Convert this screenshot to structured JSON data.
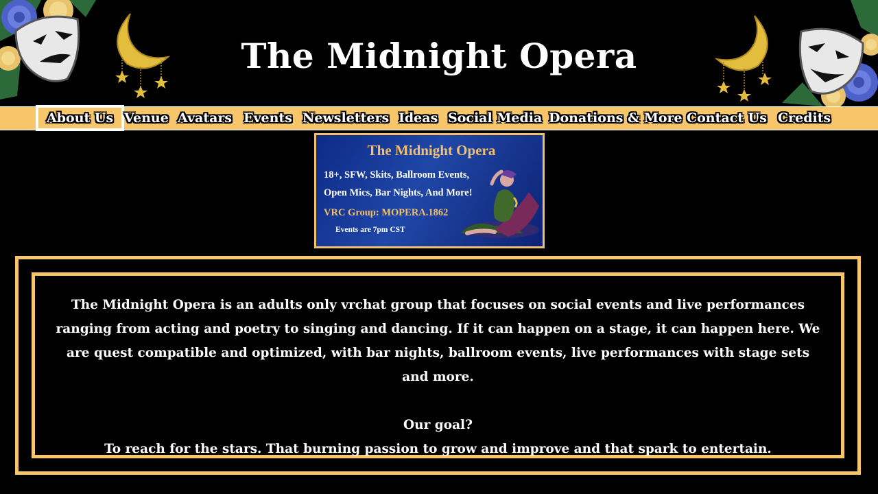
{
  "header": {
    "title": "The Midnight Opera",
    "decorations": [
      "rose-bouquet-icon",
      "comedy-mask-icon",
      "crescent-moon-icon",
      "star-icon",
      "tragedy-mask-icon"
    ]
  },
  "nav": {
    "items": [
      {
        "label": "About Us",
        "active": true
      },
      {
        "label": "Venue"
      },
      {
        "label": "Avatars"
      },
      {
        "label": "Events"
      },
      {
        "label": "Newsletters"
      },
      {
        "label": "Ideas"
      },
      {
        "label": "Social Media"
      },
      {
        "label": "Donations & More"
      },
      {
        "label": "Contact Us"
      },
      {
        "label": "Credits"
      }
    ]
  },
  "banner": {
    "title": "The Midnight Opera",
    "line1": "18+, SFW, Skits, Ballroom Events,",
    "line2": "Open Mics, Bar Nights, And More!",
    "group": "VRC Group: MOPERA.1862",
    "time": "Events are 7pm CST"
  },
  "about": {
    "paragraph": "The Midnight Opera is an adults only vrchat group that focuses on social events and live performances ranging from acting and poetry to singing and dancing. If it can happen on a stage, it can happen here. We are quest compatible and optimized, with bar nights, ballroom events, live performances with stage sets and more.",
    "goal_heading": "Our goal?",
    "goal_text": "To reach for the stars. That burning passion to grow and improve and that spark to entertain."
  },
  "colors": {
    "background": "#000000",
    "accent_gold": "#f7c66b",
    "banner_blue": "#1a3c9a",
    "text": "#ffffff"
  }
}
